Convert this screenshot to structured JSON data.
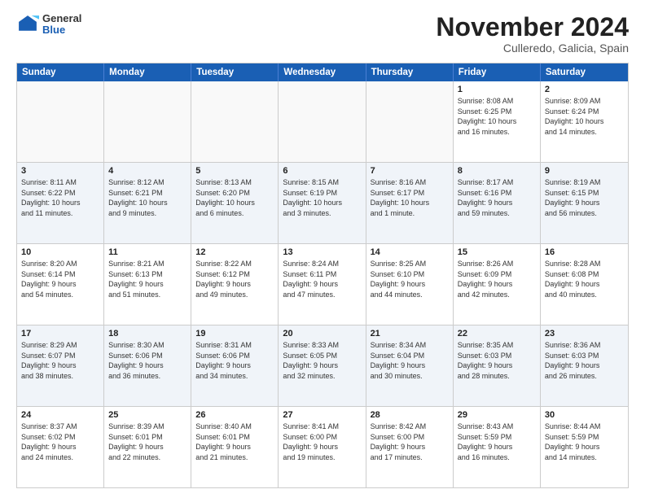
{
  "header": {
    "logo_general": "General",
    "logo_blue": "Blue",
    "month_title": "November 2024",
    "location": "Culleredo, Galicia, Spain"
  },
  "calendar": {
    "days_of_week": [
      "Sunday",
      "Monday",
      "Tuesday",
      "Wednesday",
      "Thursday",
      "Friday",
      "Saturday"
    ],
    "rows": [
      {
        "alt": false,
        "cells": [
          {
            "day": "",
            "info": "",
            "empty": true
          },
          {
            "day": "",
            "info": "",
            "empty": true
          },
          {
            "day": "",
            "info": "",
            "empty": true
          },
          {
            "day": "",
            "info": "",
            "empty": true
          },
          {
            "day": "",
            "info": "",
            "empty": true
          },
          {
            "day": "1",
            "info": "Sunrise: 8:08 AM\nSunset: 6:25 PM\nDaylight: 10 hours\nand 16 minutes.",
            "empty": false
          },
          {
            "day": "2",
            "info": "Sunrise: 8:09 AM\nSunset: 6:24 PM\nDaylight: 10 hours\nand 14 minutes.",
            "empty": false
          }
        ]
      },
      {
        "alt": true,
        "cells": [
          {
            "day": "3",
            "info": "Sunrise: 8:11 AM\nSunset: 6:22 PM\nDaylight: 10 hours\nand 11 minutes.",
            "empty": false
          },
          {
            "day": "4",
            "info": "Sunrise: 8:12 AM\nSunset: 6:21 PM\nDaylight: 10 hours\nand 9 minutes.",
            "empty": false
          },
          {
            "day": "5",
            "info": "Sunrise: 8:13 AM\nSunset: 6:20 PM\nDaylight: 10 hours\nand 6 minutes.",
            "empty": false
          },
          {
            "day": "6",
            "info": "Sunrise: 8:15 AM\nSunset: 6:19 PM\nDaylight: 10 hours\nand 3 minutes.",
            "empty": false
          },
          {
            "day": "7",
            "info": "Sunrise: 8:16 AM\nSunset: 6:17 PM\nDaylight: 10 hours\nand 1 minute.",
            "empty": false
          },
          {
            "day": "8",
            "info": "Sunrise: 8:17 AM\nSunset: 6:16 PM\nDaylight: 9 hours\nand 59 minutes.",
            "empty": false
          },
          {
            "day": "9",
            "info": "Sunrise: 8:19 AM\nSunset: 6:15 PM\nDaylight: 9 hours\nand 56 minutes.",
            "empty": false
          }
        ]
      },
      {
        "alt": false,
        "cells": [
          {
            "day": "10",
            "info": "Sunrise: 8:20 AM\nSunset: 6:14 PM\nDaylight: 9 hours\nand 54 minutes.",
            "empty": false
          },
          {
            "day": "11",
            "info": "Sunrise: 8:21 AM\nSunset: 6:13 PM\nDaylight: 9 hours\nand 51 minutes.",
            "empty": false
          },
          {
            "day": "12",
            "info": "Sunrise: 8:22 AM\nSunset: 6:12 PM\nDaylight: 9 hours\nand 49 minutes.",
            "empty": false
          },
          {
            "day": "13",
            "info": "Sunrise: 8:24 AM\nSunset: 6:11 PM\nDaylight: 9 hours\nand 47 minutes.",
            "empty": false
          },
          {
            "day": "14",
            "info": "Sunrise: 8:25 AM\nSunset: 6:10 PM\nDaylight: 9 hours\nand 44 minutes.",
            "empty": false
          },
          {
            "day": "15",
            "info": "Sunrise: 8:26 AM\nSunset: 6:09 PM\nDaylight: 9 hours\nand 42 minutes.",
            "empty": false
          },
          {
            "day": "16",
            "info": "Sunrise: 8:28 AM\nSunset: 6:08 PM\nDaylight: 9 hours\nand 40 minutes.",
            "empty": false
          }
        ]
      },
      {
        "alt": true,
        "cells": [
          {
            "day": "17",
            "info": "Sunrise: 8:29 AM\nSunset: 6:07 PM\nDaylight: 9 hours\nand 38 minutes.",
            "empty": false
          },
          {
            "day": "18",
            "info": "Sunrise: 8:30 AM\nSunset: 6:06 PM\nDaylight: 9 hours\nand 36 minutes.",
            "empty": false
          },
          {
            "day": "19",
            "info": "Sunrise: 8:31 AM\nSunset: 6:06 PM\nDaylight: 9 hours\nand 34 minutes.",
            "empty": false
          },
          {
            "day": "20",
            "info": "Sunrise: 8:33 AM\nSunset: 6:05 PM\nDaylight: 9 hours\nand 32 minutes.",
            "empty": false
          },
          {
            "day": "21",
            "info": "Sunrise: 8:34 AM\nSunset: 6:04 PM\nDaylight: 9 hours\nand 30 minutes.",
            "empty": false
          },
          {
            "day": "22",
            "info": "Sunrise: 8:35 AM\nSunset: 6:03 PM\nDaylight: 9 hours\nand 28 minutes.",
            "empty": false
          },
          {
            "day": "23",
            "info": "Sunrise: 8:36 AM\nSunset: 6:03 PM\nDaylight: 9 hours\nand 26 minutes.",
            "empty": false
          }
        ]
      },
      {
        "alt": false,
        "cells": [
          {
            "day": "24",
            "info": "Sunrise: 8:37 AM\nSunset: 6:02 PM\nDaylight: 9 hours\nand 24 minutes.",
            "empty": false
          },
          {
            "day": "25",
            "info": "Sunrise: 8:39 AM\nSunset: 6:01 PM\nDaylight: 9 hours\nand 22 minutes.",
            "empty": false
          },
          {
            "day": "26",
            "info": "Sunrise: 8:40 AM\nSunset: 6:01 PM\nDaylight: 9 hours\nand 21 minutes.",
            "empty": false
          },
          {
            "day": "27",
            "info": "Sunrise: 8:41 AM\nSunset: 6:00 PM\nDaylight: 9 hours\nand 19 minutes.",
            "empty": false
          },
          {
            "day": "28",
            "info": "Sunrise: 8:42 AM\nSunset: 6:00 PM\nDaylight: 9 hours\nand 17 minutes.",
            "empty": false
          },
          {
            "day": "29",
            "info": "Sunrise: 8:43 AM\nSunset: 5:59 PM\nDaylight: 9 hours\nand 16 minutes.",
            "empty": false
          },
          {
            "day": "30",
            "info": "Sunrise: 8:44 AM\nSunset: 5:59 PM\nDaylight: 9 hours\nand 14 minutes.",
            "empty": false
          }
        ]
      }
    ]
  }
}
